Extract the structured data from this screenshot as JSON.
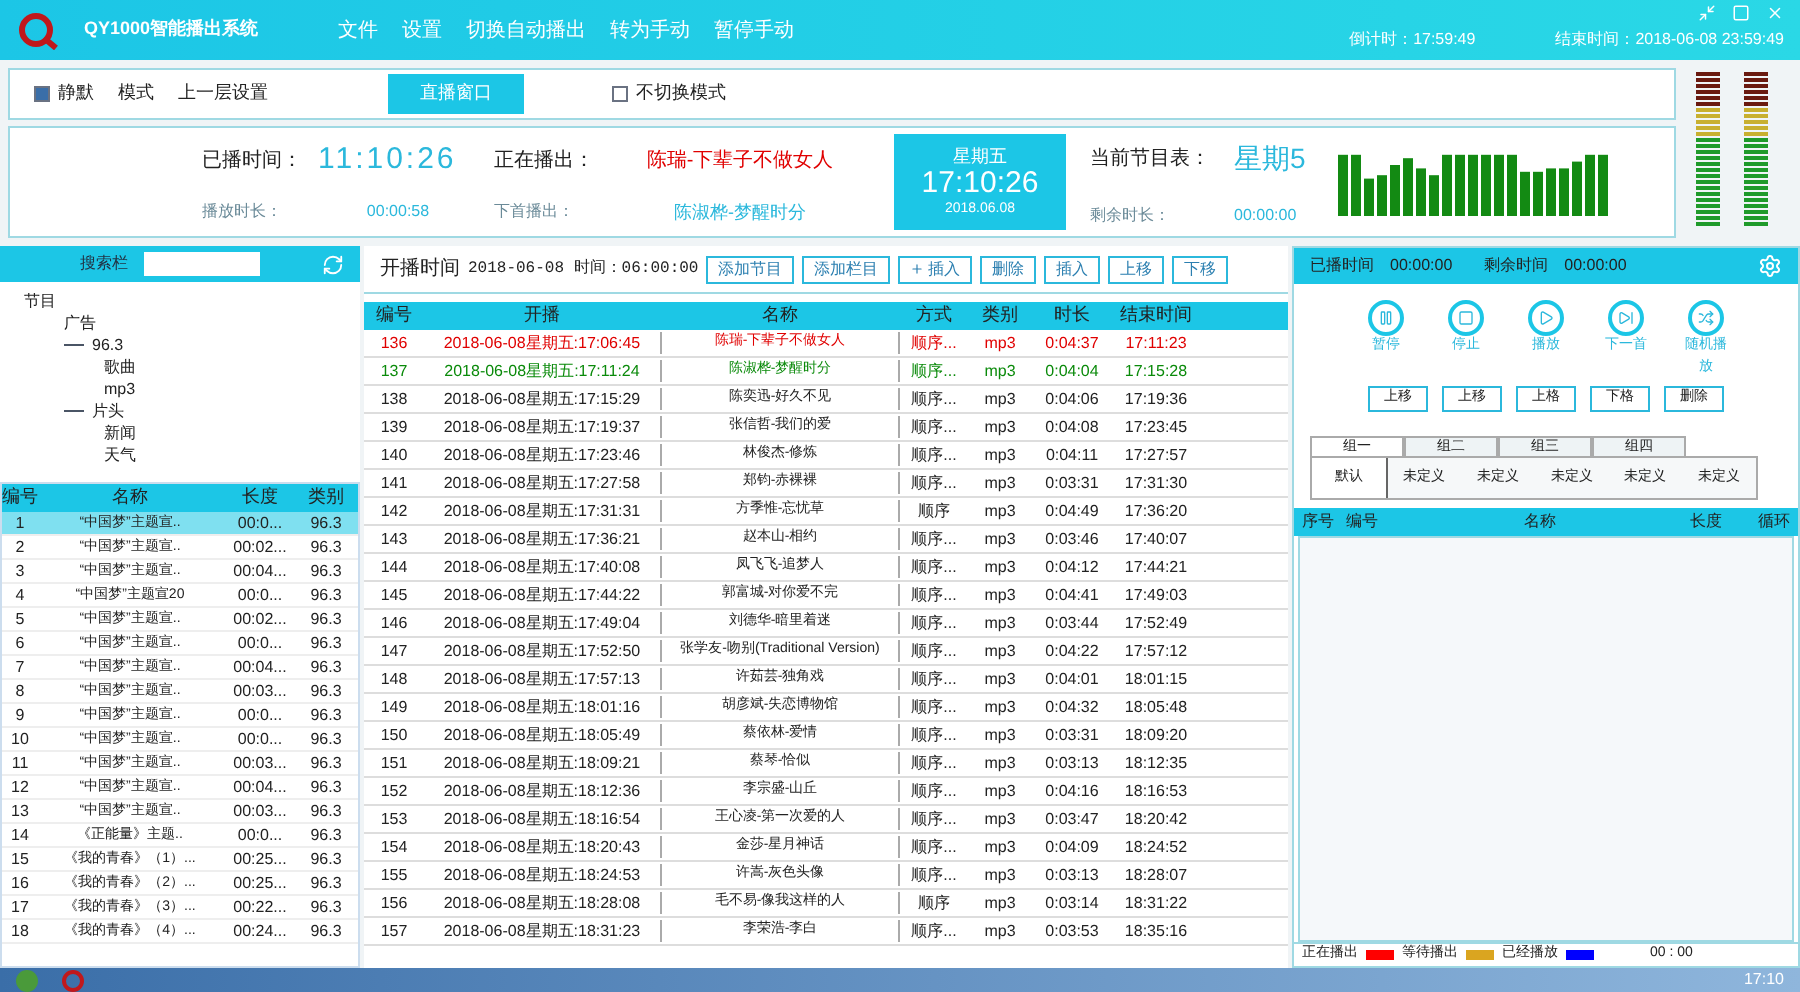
{
  "window": {
    "title": "QY1000智能播出系统",
    "menu": [
      "文件",
      "设置",
      "切换自动播出",
      "转为手动",
      "暂停手动"
    ],
    "countdown": "倒计时：17:59:49",
    "end_time": "结束时间：2018-06-08 23:59:49"
  },
  "toolbar": {
    "silent": {
      "label": "静默",
      "checked": true
    },
    "mode": "模式",
    "upper": "上一层设置",
    "live_tab": "直播窗口",
    "no_switch": {
      "label": "不切换模式",
      "checked": false
    }
  },
  "status": {
    "played_label": "已播时间：",
    "played": "11:10:26",
    "now_label": "正在播出：",
    "now": "陈瑞-下辈子不做女人",
    "weekday": "星期五",
    "clock": "17:10:26",
    "date": "2018.06.08",
    "schedule_label": "当前节目表：",
    "schedule": "星期5",
    "duration_label": "播放时长：",
    "duration": "00:00:58",
    "next_label": "下首播出：",
    "next": "陈淑桦-梦醒时分",
    "remain_label": "剩余时长：",
    "remain": "00:00:00"
  },
  "library": {
    "search_label": "搜索栏",
    "tree": [
      {
        "label": "节目",
        "children": [
          {
            "label": "广告"
          },
          {
            "label": "96.3",
            "children": [
              {
                "label": "歌曲"
              },
              {
                "label": "mp3"
              }
            ]
          },
          {
            "label": "片头",
            "children": [
              {
                "label": "新闻"
              },
              {
                "label": "天气"
              }
            ]
          }
        ]
      }
    ],
    "columns": [
      "编号",
      "名称",
      "长度",
      "类别"
    ],
    "rows": [
      {
        "cells": [
          "1",
          "“中国梦”主题宣..",
          "00:0...",
          "96.3"
        ],
        "selected": true
      },
      {
        "cells": [
          "2",
          "“中国梦”主题宣..",
          "00:02...",
          "96.3"
        ],
        "selected": false
      },
      {
        "cells": [
          "3",
          "“中国梦”主题宣..",
          "00:04...",
          "96.3"
        ],
        "selected": false
      },
      {
        "cells": [
          "4",
          "“中国梦”主题宣20",
          "00:0...",
          "96.3"
        ],
        "selected": false
      },
      {
        "cells": [
          "5",
          "“中国梦”主题宣..",
          "00:02...",
          "96.3"
        ],
        "selected": false
      },
      {
        "cells": [
          "6",
          "“中国梦”主题宣..",
          "00:0...",
          "96.3"
        ],
        "selected": false
      },
      {
        "cells": [
          "7",
          "“中国梦”主题宣..",
          "00:04...",
          "96.3"
        ],
        "selected": false
      },
      {
        "cells": [
          "8",
          "“中国梦”主题宣..",
          "00:03...",
          "96.3"
        ],
        "selected": false
      },
      {
        "cells": [
          "9",
          "“中国梦”主题宣..",
          "00:0...",
          "96.3"
        ],
        "selected": false
      },
      {
        "cells": [
          "10",
          "“中国梦”主题宣..",
          "00:0...",
          "96.3"
        ],
        "selected": false
      },
      {
        "cells": [
          "11",
          "“中国梦”主题宣..",
          "00:03...",
          "96.3"
        ],
        "selected": false
      },
      {
        "cells": [
          "12",
          "“中国梦”主题宣..",
          "00:04...",
          "96.3"
        ],
        "selected": false
      },
      {
        "cells": [
          "13",
          "“中国梦”主题宣..",
          "00:03...",
          "96.3"
        ],
        "selected": false
      },
      {
        "cells": [
          "14",
          "《正能量》主题..",
          "00:0...",
          "96.3"
        ],
        "selected": false
      },
      {
        "cells": [
          "15",
          "《我的青春》（1）...",
          "00:25...",
          "96.3"
        ],
        "selected": false
      },
      {
        "cells": [
          "16",
          "《我的青春》（2）...",
          "00:25...",
          "96.3"
        ],
        "selected": false
      },
      {
        "cells": [
          "17",
          "《我的青春》（3）...",
          "00:22...",
          "96.3"
        ],
        "selected": false
      },
      {
        "cells": [
          "18",
          "《我的青春》（4）...",
          "00:24...",
          "96.3"
        ],
        "selected": false
      }
    ]
  },
  "playlist": {
    "start_label": "开播时间",
    "start_value": "2018-06-08 时间：06:00:00",
    "buttons": [
      "添加节目",
      "添加栏目",
      "插入",
      "删除",
      "插入",
      "上移",
      "下移"
    ],
    "columns": [
      "编号",
      "开播",
      "名称",
      "方式",
      "类别",
      "时长",
      "结束时间"
    ],
    "rows": [
      {
        "color": "#e00000",
        "cells": [
          "136",
          "2018-06-08星期五:17:06:45",
          "陈瑞-下辈子不做女人",
          "顺序...",
          "mp3",
          "0:04:37",
          "17:11:23"
        ]
      },
      {
        "color": "#0a8a0a",
        "cells": [
          "137",
          "2018-06-08星期五:17:11:24",
          "陈淑桦-梦醒时分",
          "顺序...",
          "mp3",
          "0:04:04",
          "17:15:28"
        ]
      },
      {
        "cells": [
          "138",
          "2018-06-08星期五:17:15:29",
          "陈奕迅-好久不见",
          "顺序...",
          "mp3",
          "0:04:06",
          "17:19:36"
        ]
      },
      {
        "cells": [
          "139",
          "2018-06-08星期五:17:19:37",
          "张信哲-我们的爱",
          "顺序...",
          "mp3",
          "0:04:08",
          "17:23:45"
        ]
      },
      {
        "cells": [
          "140",
          "2018-06-08星期五:17:23:46",
          "林俊杰-修炼",
          "顺序...",
          "mp3",
          "0:04:11",
          "17:27:57"
        ]
      },
      {
        "cells": [
          "141",
          "2018-06-08星期五:17:27:58",
          "郑钧-赤裸裸",
          "顺序...",
          "mp3",
          "0:03:31",
          "17:31:30"
        ]
      },
      {
        "cells": [
          "142",
          "2018-06-08星期五:17:31:31",
          "方季惟-忘忧草",
          "顺序",
          "mp3",
          "0:04:49",
          "17:36:20"
        ]
      },
      {
        "cells": [
          "143",
          "2018-06-08星期五:17:36:21",
          "赵本山-相约",
          "顺序...",
          "mp3",
          "0:03:46",
          "17:40:07"
        ]
      },
      {
        "cells": [
          "144",
          "2018-06-08星期五:17:40:08",
          "凤飞飞-追梦人",
          "顺序...",
          "mp3",
          "0:04:12",
          "17:44:21"
        ]
      },
      {
        "cells": [
          "145",
          "2018-06-08星期五:17:44:22",
          "郭富城-对你爱不完",
          "顺序...",
          "mp3",
          "0:04:41",
          "17:49:03"
        ]
      },
      {
        "cells": [
          "146",
          "2018-06-08星期五:17:49:04",
          "刘德华-暗里着迷",
          "顺序...",
          "mp3",
          "0:03:44",
          "17:52:49"
        ]
      },
      {
        "cells": [
          "147",
          "2018-06-08星期五:17:52:50",
          "张学友-吻别(Traditional Version)",
          "顺序...",
          "mp3",
          "0:04:22",
          "17:57:12"
        ]
      },
      {
        "cells": [
          "148",
          "2018-06-08星期五:17:57:13",
          "许茹芸-独角戏",
          "顺序...",
          "mp3",
          "0:04:01",
          "18:01:15"
        ]
      },
      {
        "cells": [
          "149",
          "2018-06-08星期五:18:01:16",
          "胡彦斌-失恋博物馆",
          "顺序...",
          "mp3",
          "0:04:32",
          "18:05:48"
        ]
      },
      {
        "cells": [
          "150",
          "2018-06-08星期五:18:05:49",
          "蔡依林-爱情",
          "顺序...",
          "mp3",
          "0:03:31",
          "18:09:20"
        ]
      },
      {
        "cells": [
          "151",
          "2018-06-08星期五:18:09:21",
          "蔡琴-恰似",
          "顺序...",
          "mp3",
          "0:03:13",
          "18:12:35"
        ]
      },
      {
        "cells": [
          "152",
          "2018-06-08星期五:18:12:36",
          "李宗盛-山丘",
          "顺序...",
          "mp3",
          "0:04:16",
          "18:16:53"
        ]
      },
      {
        "cells": [
          "153",
          "2018-06-08星期五:18:16:54",
          "王心凌-第一次爱的人",
          "顺序...",
          "mp3",
          "0:03:47",
          "18:20:42"
        ]
      },
      {
        "cells": [
          "154",
          "2018-06-08星期五:18:20:43",
          "金莎-星月神话",
          "顺序...",
          "mp3",
          "0:04:09",
          "18:24:52"
        ]
      },
      {
        "cells": [
          "155",
          "2018-06-08星期五:18:24:53",
          "许嵩-灰色头像",
          "顺序...",
          "mp3",
          "0:03:13",
          "18:28:07"
        ]
      },
      {
        "cells": [
          "156",
          "2018-06-08星期五:18:28:08",
          "毛不易-像我这样的人",
          "顺序",
          "mp3",
          "0:03:14",
          "18:31:22"
        ]
      },
      {
        "cells": [
          "157",
          "2018-06-08星期五:18:31:23",
          "李荣浩-李白",
          "顺序...",
          "mp3",
          "0:03:53",
          "18:35:16"
        ]
      }
    ]
  },
  "player": {
    "played_label": "已播时间",
    "played": "00:00:00",
    "remain_label": "剩余时间",
    "remain": "00:00:00",
    "controls": [
      {
        "kind": "pause",
        "label": "暂停"
      },
      {
        "kind": "stop",
        "label": "停止"
      },
      {
        "kind": "play",
        "label": "播放"
      },
      {
        "kind": "next",
        "label": "下一首"
      },
      {
        "kind": "shuffle",
        "label": "随机播放"
      }
    ],
    "buttons": [
      "上移",
      "上移",
      "上格",
      "下格",
      "删除"
    ],
    "groups": [
      {
        "label": "组一",
        "selected": true
      },
      {
        "label": "组二",
        "selected": false
      },
      {
        "label": "组三",
        "selected": false
      },
      {
        "label": "组四",
        "selected": false
      }
    ],
    "slots": [
      {
        "label": "默认",
        "selected": true
      },
      {
        "label": "未定义",
        "selected": false
      },
      {
        "label": "未定义",
        "selected": false
      },
      {
        "label": "未定义",
        "selected": false
      },
      {
        "label": "未定义",
        "selected": false
      },
      {
        "label": "未定义",
        "selected": false
      }
    ],
    "columns": [
      "序号",
      "编号",
      "名称",
      "长度",
      "循环"
    ],
    "legend": [
      {
        "label": "正在播出",
        "color": "#ff0000"
      },
      {
        "label": "等待播出",
        "color": "#daa520"
      },
      {
        "label": "已经播放",
        "color": "#0000ff"
      }
    ],
    "timer": "00 : 00"
  },
  "taskbar": {
    "clock": "17:10"
  }
}
